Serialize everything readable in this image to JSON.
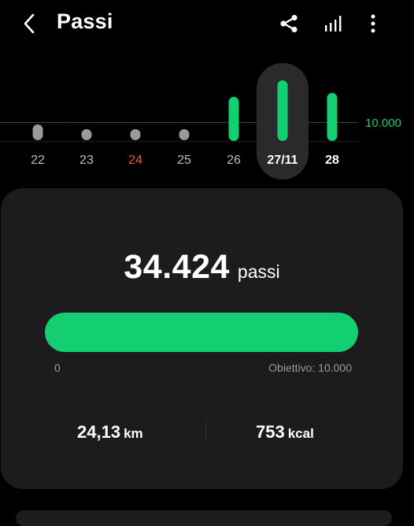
{
  "header": {
    "title": "Passi",
    "back_icon": "chevron-left-icon",
    "share_icon": "share-icon",
    "stats_icon": "bar-stats-icon",
    "more_icon": "more-vertical-icon"
  },
  "day_strip": {
    "goal_label": "10.000",
    "goal_steps": 10000,
    "days": [
      {
        "label": "22",
        "has_activity": false,
        "sunday": false,
        "selected": false,
        "bold": false,
        "bar_color": "#9a9a9a"
      },
      {
        "label": "23",
        "has_activity": false,
        "sunday": false,
        "selected": false,
        "bold": false,
        "bar_color": "#9a9a9a"
      },
      {
        "label": "24",
        "has_activity": false,
        "sunday": true,
        "selected": false,
        "bold": false,
        "bar_color": "#9a9a9a"
      },
      {
        "label": "25",
        "has_activity": false,
        "sunday": false,
        "selected": false,
        "bold": false,
        "bar_color": "#9a9a9a"
      },
      {
        "label": "26",
        "has_activity": true,
        "sunday": false,
        "selected": false,
        "bold": false,
        "bar_color": "#14cf72"
      },
      {
        "label": "27/11",
        "has_activity": true,
        "sunday": false,
        "selected": true,
        "bold": true,
        "bar_color": "#14cf72"
      },
      {
        "label": "28",
        "has_activity": true,
        "sunday": false,
        "selected": false,
        "bold": true,
        "bar_color": "#14cf72"
      }
    ],
    "colors": {
      "accent": "#14cf72",
      "sunday": "#f0574a",
      "inactive": "#9a9a9a"
    }
  },
  "summary": {
    "steps_value": "34.424",
    "steps_unit": "passi",
    "progress_min": "0",
    "progress_goal": "Obiettivo: 10.000",
    "progress_fraction": 1.0,
    "distance_value": "24,13",
    "distance_unit": "km",
    "energy_value": "753",
    "energy_unit": "kcal"
  }
}
